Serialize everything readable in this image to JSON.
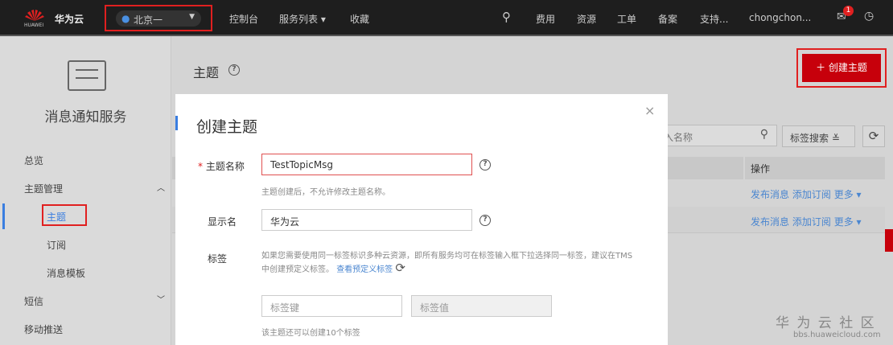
{
  "topbar": {
    "brand": "华为云",
    "logo_text": "HUAWEI",
    "region": "北京一",
    "nav": [
      "控制台",
      "服务列表 ▾",
      "收藏"
    ],
    "right": [
      "费用",
      "资源",
      "工单",
      "备案",
      "支持..."
    ],
    "user": "chongchon...",
    "badge": "1"
  },
  "sidebar": {
    "service_title": "消息通知服务",
    "items": [
      "总览",
      "主题管理",
      "主题",
      "订阅",
      "消息模板",
      "短信",
      "移动推送"
    ]
  },
  "main": {
    "title": "主题",
    "create_button": "创建主题",
    "search_placeholder": "入名称",
    "tag_search": "标签搜索",
    "col_action": "操作",
    "row_actions": [
      "发布消息",
      "添加订阅",
      "更多 ▾"
    ]
  },
  "modal": {
    "title": "创建主题",
    "name_label": "主题名称",
    "name_value": "TestTopicMsg",
    "name_hint": "主题创建后，不允许修改主题名称。",
    "display_label": "显示名",
    "display_value": "华为云",
    "tag_label": "标签",
    "tag_desc": "如果您需要使用同一标签标识多种云资源，即所有服务均可在标签输入框下拉选择同一标签，建议在TMS中创建预定义标签。",
    "tag_link": "查看预定义标签",
    "tag_key_placeholder": "标签键",
    "tag_value_placeholder": "标签值",
    "tag_hint": "该主题还可以创建10个标签"
  },
  "watermark": {
    "title": "华 为 云 社 区",
    "url": "bbs.huaweicloud.com"
  }
}
